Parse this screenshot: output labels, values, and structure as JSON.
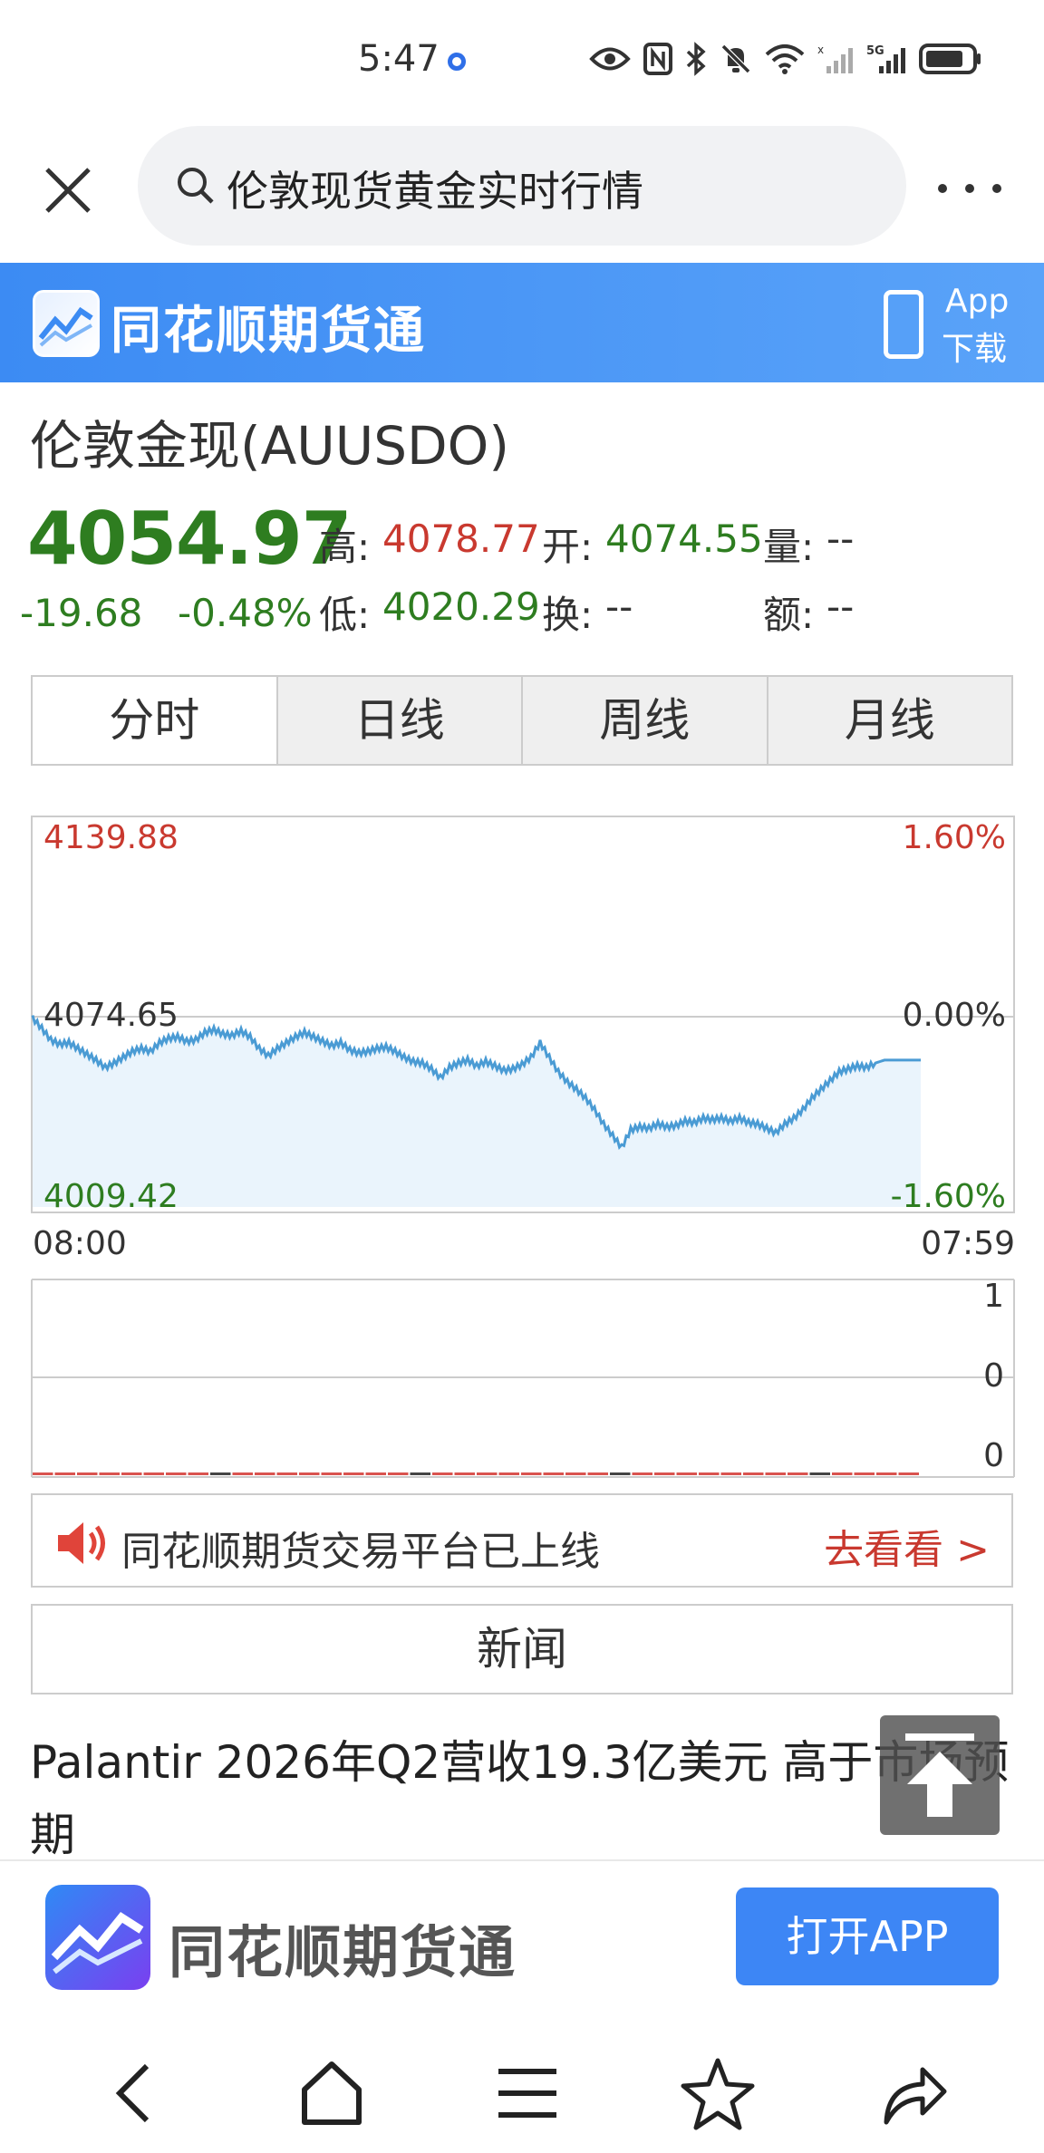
{
  "status": {
    "time": "5:47",
    "network": "5G"
  },
  "search": {
    "query": "伦敦现货黄金实时行情"
  },
  "brand": {
    "title": "同花顺期货通",
    "app_line1": "App",
    "app_line2": "下载"
  },
  "quote": {
    "name": "伦敦金现(AUUSDO)",
    "price": "4054.97",
    "change": "-19.68",
    "change_pct": "-0.48%",
    "high_label": "高:",
    "high": "4078.77",
    "open_label": "开:",
    "open": "4074.55",
    "volume_label": "量:",
    "volume": "--",
    "low_label": "低:",
    "low": "4020.29",
    "turnover_label": "换:",
    "turnover": "--",
    "amount_label": "额:",
    "amount": "--"
  },
  "tabs": [
    "分时",
    "日线",
    "周线",
    "月线"
  ],
  "colors": {
    "up": "#c9392f",
    "down": "#2e7d20",
    "line": "#4a9bd4",
    "fill": "#eaf4fc",
    "accent": "#3d86f5"
  },
  "chart_data": {
    "type": "area",
    "y_left_ticks": [
      "4139.88",
      "4074.65",
      "4009.42"
    ],
    "y_right_ticks": [
      "1.60%",
      "0.00%",
      "-1.60%"
    ],
    "x_ticks": [
      "08:00",
      "07:59"
    ],
    "ylim": [
      4009.42,
      4139.88
    ],
    "reference": 4074.65,
    "values": [
      4074.5,
      4071,
      4067,
      4065.5,
      4066,
      4064,
      4062,
      4060,
      4057.5,
      4059,
      4061,
      4063,
      4064,
      4063,
      4066,
      4067.5,
      4068,
      4066.5,
      4067,
      4069.5,
      4070.5,
      4069,
      4068.5,
      4070,
      4068,
      4064,
      4061.5,
      4064,
      4066,
      4068,
      4069.5,
      4068,
      4066.5,
      4065,
      4066,
      4063.5,
      4062.5,
      4063,
      4064,
      4064.5,
      4063,
      4061,
      4059.5,
      4059,
      4057,
      4054,
      4057.5,
      4059,
      4060,
      4058,
      4059.5,
      4058,
      4056.5,
      4057,
      4058.5,
      4061,
      4066,
      4061,
      4056,
      4052.5,
      4050,
      4047,
      4043,
      4038,
      4034,
      4030,
      4036,
      4037,
      4036.5,
      4038,
      4037,
      4037.5,
      4039,
      4038.5,
      4040,
      4039.5,
      4040,
      4039,
      4040,
      4038.5,
      4038,
      4036.5,
      4035,
      4038,
      4040,
      4043,
      4047,
      4050,
      4053,
      4056,
      4057,
      4058,
      4057.5,
      4059,
      4060,
      4060,
      4060,
      4060,
      4060
    ],
    "volume_ticks": [
      "1",
      "0",
      "0"
    ],
    "volume_values": [
      0,
      0,
      0,
      0,
      0,
      0,
      0,
      0,
      0,
      0,
      0,
      0,
      0,
      0,
      0,
      0,
      0,
      0,
      0,
      0,
      0,
      0,
      0,
      0,
      0,
      0,
      0,
      0,
      0,
      0,
      0,
      0,
      0,
      0,
      0,
      0,
      0,
      0,
      0,
      0
    ]
  },
  "notice": {
    "text": "同花顺期货交易平台已上线",
    "link": "去看看 >"
  },
  "news": {
    "header": "新闻",
    "headline": "Palantir 2026年Q2营收19.3亿美元 高于市场预期"
  },
  "banner": {
    "title": "同花顺期货通",
    "button": "打开APP"
  }
}
